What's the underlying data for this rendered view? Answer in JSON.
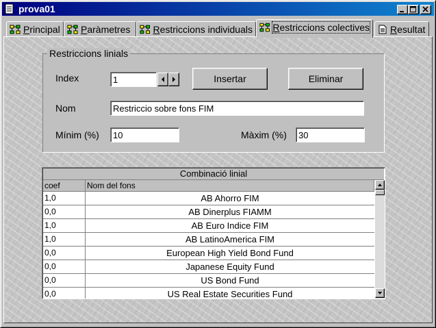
{
  "window": {
    "title": "prova01"
  },
  "tabs": [
    {
      "label": "Principal"
    },
    {
      "label": "Paràmetres"
    },
    {
      "label": "Restriccions individuals"
    },
    {
      "label": "Restriccions colectives"
    },
    {
      "label": "Resultat"
    }
  ],
  "group": {
    "title": "Restriccions linials",
    "index_label": "Index",
    "index_value": "1",
    "insert_label": "Insertar",
    "delete_label": "Eliminar",
    "name_label": "Nom",
    "name_value": "Restriccio sobre fons FIM",
    "min_label": "Mínim (%)",
    "min_value": "10",
    "max_label": "Màxim (%)",
    "max_value": "30"
  },
  "grid": {
    "title": "Combinació linial",
    "columns": [
      "coef",
      "Nom del fons"
    ],
    "rows": [
      {
        "coef": "1,0",
        "name": "AB Ahorro FIM"
      },
      {
        "coef": "0,0",
        "name": "AB Dinerplus FIAMM"
      },
      {
        "coef": "1,0",
        "name": "AB Euro Indice FIM"
      },
      {
        "coef": "1,0",
        "name": "AB LatinoAmerica FIM"
      },
      {
        "coef": "0,0",
        "name": "European High Yield Bond Fund"
      },
      {
        "coef": "0,0",
        "name": "Japanese Equity Fund"
      },
      {
        "coef": "0,0",
        "name": "US Bond Fund"
      },
      {
        "coef": "0,0",
        "name": "US Real Estate Securities Fund"
      }
    ]
  }
}
